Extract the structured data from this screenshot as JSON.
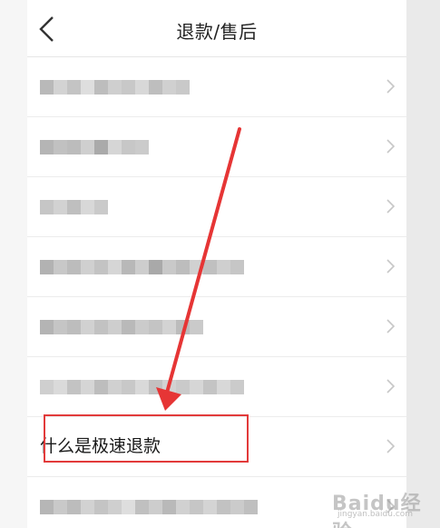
{
  "nav": {
    "title": "退款/售后"
  },
  "list": {
    "items": [
      {
        "text": "",
        "blurred": true,
        "blocks": [
          15,
          "#b9b9b9",
          15,
          "#d3d3d3",
          15,
          "#c4c4c4",
          15,
          "#dedede",
          15,
          "#bdbdbd",
          15,
          "#cfcfcf",
          15,
          "#c8c8c8",
          15,
          "#d8d8d8",
          15,
          "#bebebe",
          15,
          "#d0d0d0",
          15,
          "#c9c9c9"
        ]
      },
      {
        "text": "",
        "blurred": true,
        "blocks": [
          15,
          "#b5b5b5",
          15,
          "#c1c1c1",
          15,
          "#bcbcbc",
          15,
          "#cfcfcf",
          15,
          "#aaaaaa",
          15,
          "#d6d6d6",
          15,
          "#c7c7c7",
          15,
          "#cbcbcb"
        ]
      },
      {
        "text": "",
        "blurred": true,
        "blocks": [
          15,
          "#c6c6c6",
          15,
          "#d2d2d2",
          15,
          "#bfbfbf",
          15,
          "#d8d8d8",
          15,
          "#cacaca"
        ]
      },
      {
        "text": "",
        "blurred": true,
        "blocks": [
          15,
          "#b2b2b2",
          15,
          "#c8c8c8",
          15,
          "#bcbcbc",
          15,
          "#d0d0d0",
          15,
          "#c3c3c3",
          15,
          "#d6d6d6",
          15,
          "#b8b8b8",
          15,
          "#cdcdcd",
          15,
          "#a9a9a9",
          15,
          "#c9c9c9",
          15,
          "#bdbdbd",
          15,
          "#d1d1d1",
          15,
          "#c0c0c0",
          15,
          "#cfcfcf",
          15,
          "#c6c6c6"
        ]
      },
      {
        "text": "",
        "blurred": true,
        "blocks": [
          15,
          "#b4b4b4",
          15,
          "#c5c5c5",
          15,
          "#bdbdbd",
          15,
          "#d1d1d1",
          15,
          "#c2c2c2",
          15,
          "#cecece",
          15,
          "#b9b9b9",
          15,
          "#cbcbcb",
          15,
          "#c4c4c4",
          15,
          "#d3d3d3",
          15,
          "#bcbcbc",
          15,
          "#cacaca"
        ]
      },
      {
        "text": "",
        "blurred": true,
        "blocks": [
          15,
          "#cfcfcf",
          15,
          "#dadada",
          15,
          "#c3c3c3",
          15,
          "#d5d5d5",
          15,
          "#bdbdbd",
          15,
          "#d0d0d0",
          15,
          "#c8c8c8",
          15,
          "#d9d9d9",
          15,
          "#c1c1c1",
          15,
          "#d2d2d2",
          15,
          "#cacaca",
          15,
          "#d6d6d6",
          15,
          "#c4c4c4",
          15,
          "#d8d8d8",
          15,
          "#cbcbcb"
        ]
      },
      {
        "text": "什么是极速退款",
        "blurred": false,
        "blocks": []
      },
      {
        "text": "",
        "blurred": true,
        "blocks": [
          15,
          "#b6b6b6",
          15,
          "#c9c9c9",
          15,
          "#bcbcbc",
          15,
          "#d2d2d2",
          15,
          "#c4c4c4",
          15,
          "#cfcfcf",
          15,
          "#dedede",
          15,
          "#c0c0c0",
          15,
          "#cdcdcd",
          15,
          "#b9b9b9",
          15,
          "#d1d1d1",
          15,
          "#c6c6c6",
          15,
          "#d4d4d4",
          15,
          "#c2c2c2",
          15,
          "#cbcbcb",
          15,
          "#bfbfbf"
        ]
      }
    ]
  },
  "watermark": {
    "brand": "Baidu经验",
    "url": "jingyan.baidu.com"
  },
  "colors": {
    "highlight": "#e23a3a",
    "chevron": "#c7c7c7"
  },
  "icons": {
    "back": "back-chevron-icon",
    "row": "chevron-right-icon",
    "annotation": "red-arrow-annotation"
  }
}
